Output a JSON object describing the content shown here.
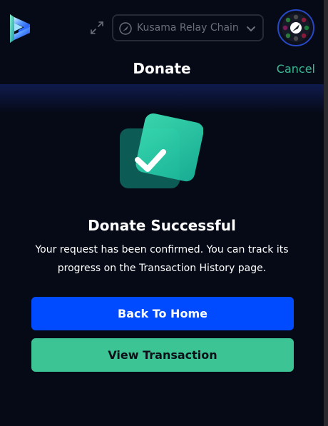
{
  "header": {
    "network": {
      "label": "Kusama Relay Chain",
      "icon": "kusama-network-icon"
    },
    "expand_icon": "expand-icon",
    "chevron_icon": "chevron-down-icon",
    "avatar_icon": "account-avatar-icon"
  },
  "page": {
    "title": "Donate",
    "cancel_label": "Cancel"
  },
  "result": {
    "icon": "success-check-icon",
    "title": "Donate Successful",
    "description": "Your request has been confirmed. You can track its progress on the Transaction History page."
  },
  "actions": {
    "back_home_label": "Back To Home",
    "view_transaction_label": "View Transaction"
  },
  "colors": {
    "background": "#060a17",
    "primary": "#004bff",
    "secondary": "#3cc495",
    "cancel": "#3bb892"
  }
}
